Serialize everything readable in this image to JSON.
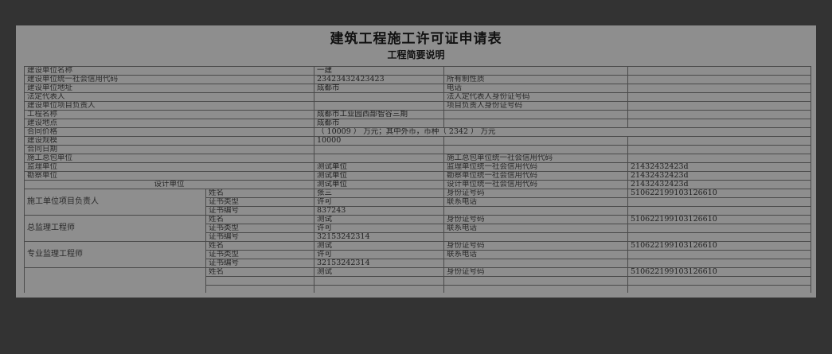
{
  "title": "建筑工程施工许可证申请表",
  "subtitle": "工程简要说明",
  "rows": [
    {
      "l1": "建设单位名称",
      "v1": "一建",
      "l2": "",
      "v2": ""
    },
    {
      "l1": "建设单位统一社会信用代码",
      "v1": "23423432423423",
      "l2": "所有制性质",
      "v2": ""
    },
    {
      "l1": "建设单位地址",
      "v1": "成都市",
      "l2": "电话",
      "v2": ""
    },
    {
      "l1": "法定代表人",
      "v1": "",
      "l2": "法人定代表人身份证号码",
      "v2": ""
    },
    {
      "l1": "建设单位项目负责人",
      "v1": "",
      "l2": "项目负责人身份证号码",
      "v2": ""
    },
    {
      "l1": "工程名称",
      "v1": "成都市工业园西部智谷三期",
      "l2": "",
      "v2": ""
    },
    {
      "l1": "建设地点",
      "v1": "成都市",
      "l2": "",
      "v2": ""
    },
    {
      "l1": "合同价格",
      "v1": "（ 10009 ） 万元；其中外币，币种（ 2342 ） 万元",
      "l2": "",
      "v2": ""
    },
    {
      "l1": "建设规模",
      "v1": "10000",
      "l2": "",
      "v2": ""
    },
    {
      "l1": "合同日期",
      "v1": "",
      "l2": "",
      "v2": ""
    },
    {
      "l1": "施工总包单位",
      "v1": "",
      "l2": "施工总包单位统一社会信用代码",
      "v2": ""
    },
    {
      "l1": "监理单位",
      "v1": "测试单位",
      "l2": "监理单位统一社会信用代码",
      "v2": "21432432423d"
    },
    {
      "l1": "勘察单位",
      "v1": "测试单位",
      "l2": "勘察单位统一社会信用代码",
      "v2": "21432432423d"
    },
    {
      "l1": "设计单位",
      "v1": "测试单位",
      "l2": "设计单位统一社会信用代码",
      "v2": "21432432423d"
    }
  ],
  "persons": [
    {
      "role": "施工单位项目负责人",
      "name_label": "姓名",
      "name": "张三",
      "id_label": "身份证号码",
      "id": "510622199103126610",
      "cert_type_label": "证书类型",
      "cert_type": "许可",
      "phone_label": "联系电话",
      "cert_no_label": "证书编号",
      "cert_no": "837243"
    },
    {
      "role": "总监理工程师",
      "name_label": "姓名",
      "name": "测试",
      "id_label": "身份证号码",
      "id": "510622199103126610",
      "cert_type_label": "证书类型",
      "cert_type": "许可",
      "phone_label": "联系电话",
      "cert_no_label": "证书编号",
      "cert_no": "32153242314"
    },
    {
      "role": "专业监理工程师",
      "name_label": "姓名",
      "name": "测试",
      "id_label": "身份证号码",
      "id": "510622199103126610",
      "cert_type_label": "证书类型",
      "cert_type": "许可",
      "phone_label": "联系电话",
      "cert_no_label": "证书编号",
      "cert_no": "32153242314"
    },
    {
      "role": "",
      "name_label": "姓名",
      "name": "测试",
      "id_label": "身份证号码",
      "id": "510622199103126610",
      "cert_type_label": "",
      "cert_type": "",
      "phone_label": "",
      "cert_no_label": "",
      "cert_no": ""
    }
  ]
}
